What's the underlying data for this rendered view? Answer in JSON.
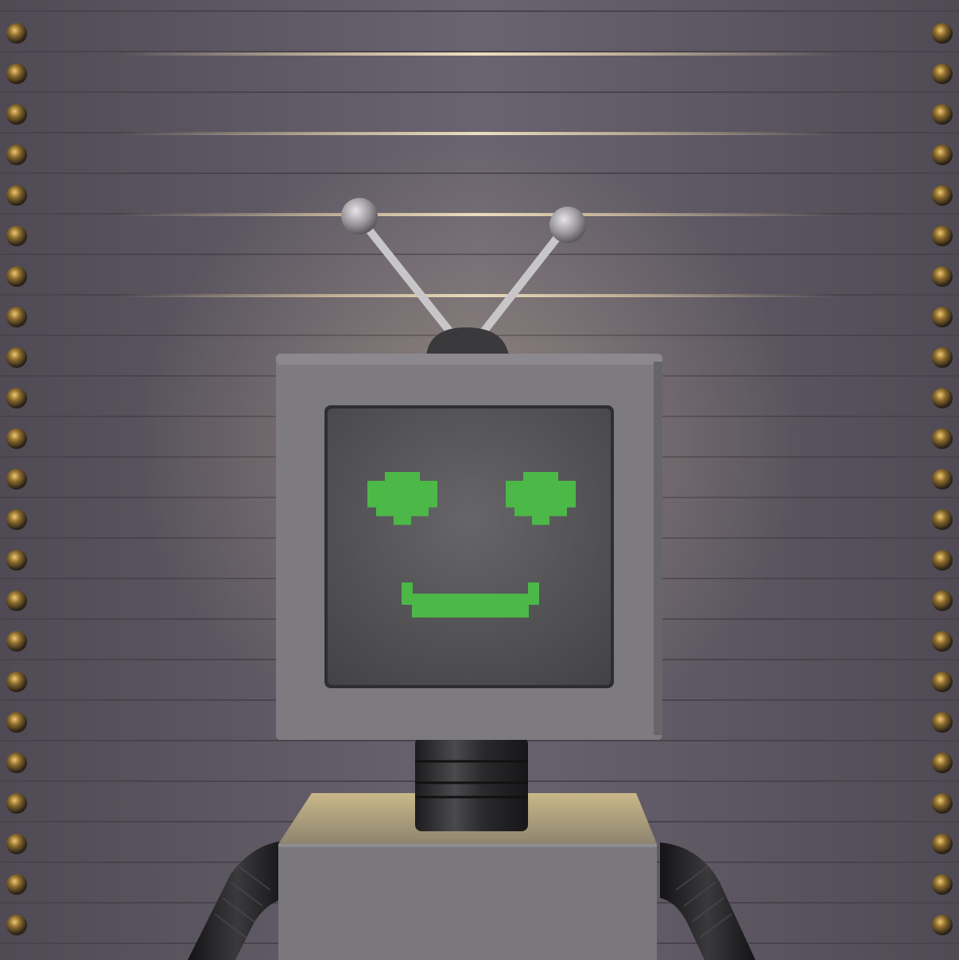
{
  "scene": {
    "subject": "robot-tv-head",
    "colors": {
      "wall": "#5f5a63",
      "wall_light": "#7a7480",
      "plank_highlight": "#e8d6b0",
      "rivet": "#8a6a2c",
      "tv_body": "#7d7b80",
      "tv_body_shade": "#67656a",
      "screen": "#505052",
      "screen_glow": "#5e5e60",
      "face_green": "#4cb848",
      "antenna": "#c9c6c9",
      "neck": "#2a2a2c",
      "torso": "#7a787c",
      "torso_top": "#a89a78",
      "arm": "#2b2b2d"
    },
    "icons": [
      "rivet-icon",
      "antenna-ball-icon"
    ]
  }
}
